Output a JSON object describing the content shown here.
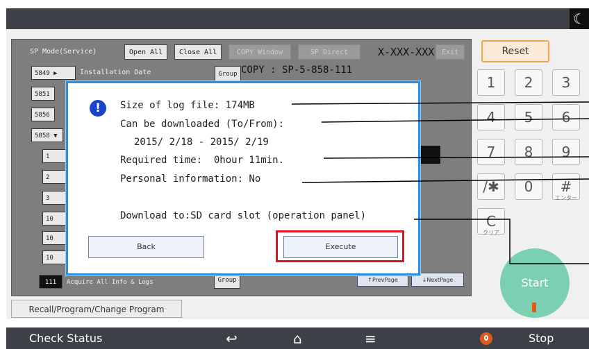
{
  "topbar": {
    "moon_icon": "moon-icon"
  },
  "sp": {
    "title": "SP Mode(Service)",
    "open_all": "Open All",
    "close_all": "Close All",
    "copy_window": "COPY Window",
    "sp_direct": "SP Direct",
    "code": "X-XXX-XXX",
    "exit": "Exit",
    "group_label": "Group",
    "copy_code": "COPY : SP-5-858-111",
    "row_5849": "5849 ▶",
    "row_5849_label": "Installation Date",
    "row_5851": "5851",
    "row_5856": "5856",
    "row_5858": "5858 ▼",
    "sub_1": "1",
    "sub_2": "2",
    "sub_3": "3",
    "sub_10a": "10",
    "sub_10b": "10",
    "sub_10c": "10",
    "acquire_num": "111",
    "acquire_label": "Acquire All Info & Logs",
    "group_bottom": "Group",
    "prev_page": "↑PrevPage",
    "next_page": "↓NextPage"
  },
  "recall_label": "Recall/Program/Change Program",
  "keypad": {
    "reset": "Reset",
    "keys": [
      "1",
      "2",
      "3",
      "4",
      "5",
      "6",
      "7",
      "8",
      "9",
      "/✱",
      "0",
      "#",
      "C"
    ],
    "enter_sub": "エンター",
    "clear_sub": "クリア",
    "start": "Start"
  },
  "dialog": {
    "size": "Size of log file: 174MB",
    "can_download": "Can be downloaded (To/From):",
    "date_range": "2015/ 2/18 - 2015/ 2/19",
    "required_time": "Required time:  0hour 11min.",
    "personal": "Personal information: No",
    "download_to": "Download to:SD card slot (operation panel)",
    "back": "Back",
    "execute": "Execute",
    "highlight_color": "#e0141e"
  },
  "bottombar": {
    "check_status": "Check Status",
    "back_icon": "back-arrow-icon",
    "home_icon": "home-icon",
    "menu_icon": "menu-icon",
    "stop": "Stop"
  }
}
